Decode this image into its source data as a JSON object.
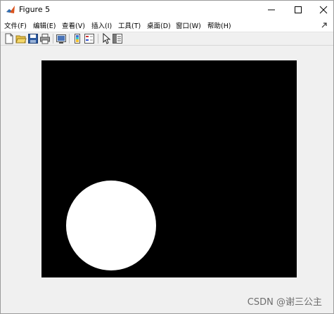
{
  "window": {
    "title": "Figure 5"
  },
  "menu": {
    "items": [
      "文件(F)",
      "编辑(E)",
      "查看(V)",
      "插入(I)",
      "工具(T)",
      "桌面(D)",
      "窗口(W)",
      "帮助(H)"
    ]
  },
  "toolbar": {
    "buttons": [
      "new-figure-icon",
      "open-file-icon",
      "save-icon",
      "print-icon",
      "link-plot-icon",
      "insert-colorbar-icon",
      "insert-legend-icon",
      "pointer-icon",
      "property-inspector-icon"
    ]
  },
  "figure": {
    "background": "#000000",
    "shape": "circle",
    "shape_color": "#ffffff"
  },
  "watermark": "CSDN @谢三公主"
}
